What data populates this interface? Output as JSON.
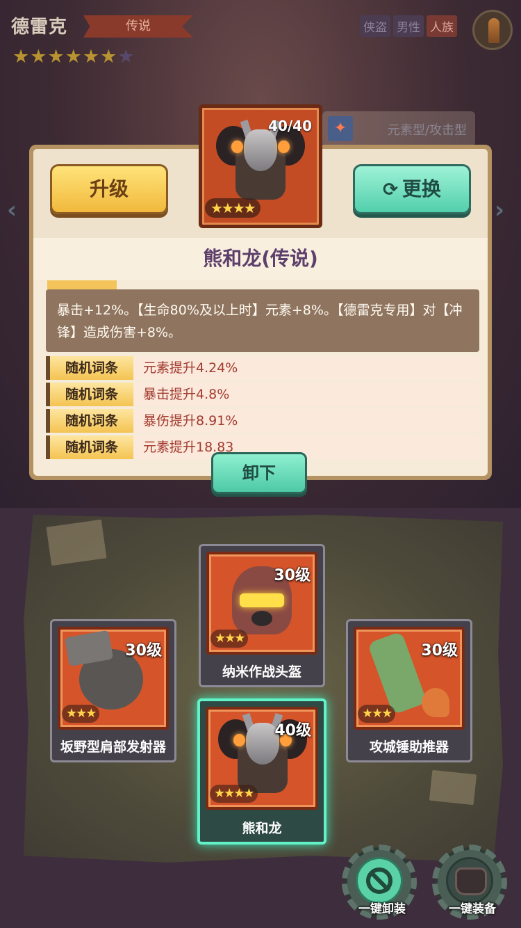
{
  "hero": {
    "name": "德雷克",
    "rarity": "传说",
    "stars_filled": 6,
    "stars_total": 7,
    "tags": [
      "侠盗",
      "男性",
      "人族"
    ],
    "type": "元素型/攻击型"
  },
  "selected_item": {
    "level": "40/40",
    "name": "熊和龙(传说)",
    "stars": 4,
    "description": "暴击+12%。【生命80%及以上时】元素+8%。【德雷克专用】对【冲锋】造成伤害+8%。",
    "affix_label": "随机词条",
    "affixes": [
      "元素提升4.24%",
      "暴击提升4.8%",
      "暴伤提升8.91%",
      "元素提升18.83"
    ]
  },
  "buttons": {
    "upgrade": "升级",
    "swap": "更换",
    "unequip": "卸下",
    "unequip_all": "一键卸装",
    "equip_all": "一键装备"
  },
  "slots": {
    "helmet": {
      "level": "30级",
      "name": "纳米作战头盔",
      "stars": 3
    },
    "shoulder": {
      "level": "30级",
      "name": "坂野型肩部发射器",
      "stars": 3
    },
    "booster": {
      "level": "30级",
      "name": "攻城锤助推器",
      "stars": 3
    },
    "armor": {
      "level": "40级",
      "name": "熊和龙",
      "stars": 4
    }
  },
  "colors": {
    "accent_teal": "#63f2c8",
    "upgrade_gold": "#f1b93c",
    "card_orange": "#d6542a"
  }
}
